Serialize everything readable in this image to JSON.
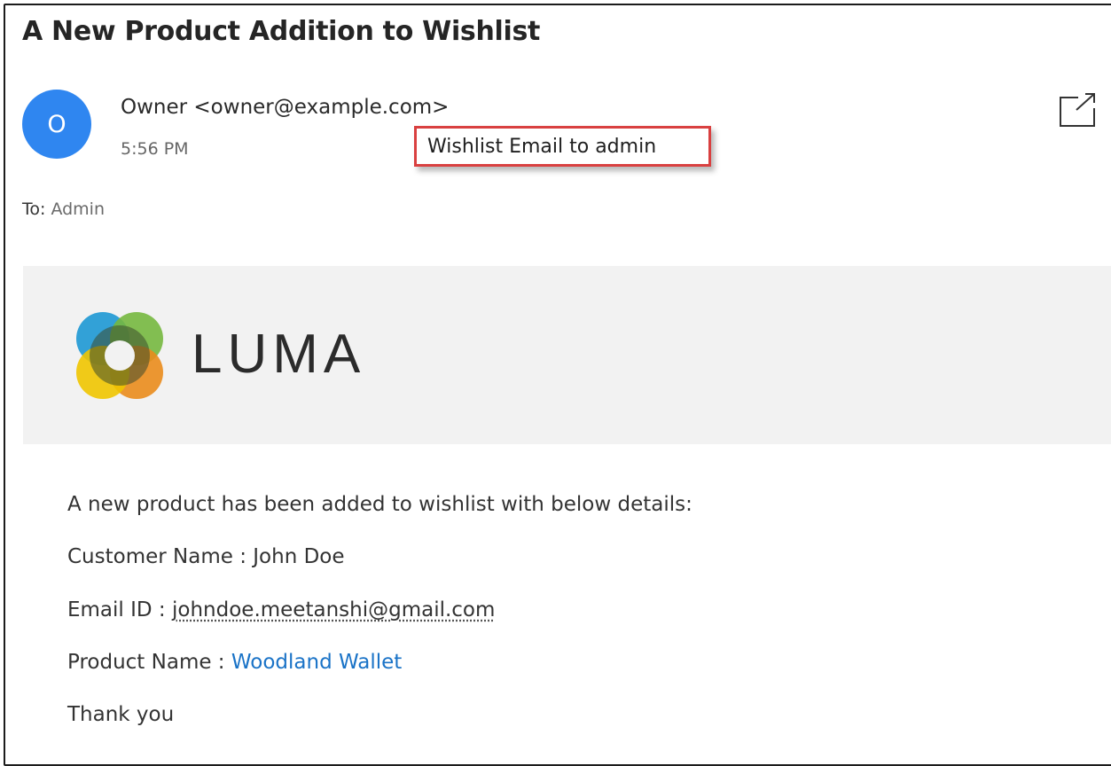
{
  "email": {
    "subject": "A New Product Addition to Wishlist",
    "avatar_initial": "O",
    "sender": "Owner <owner@example.com>",
    "time": "5:56 PM",
    "to_label": "To:",
    "to_value": "Admin",
    "annotation": "Wishlist Email to admin"
  },
  "logo": {
    "text": "LUMA",
    "colors": [
      "#1ea1e0",
      "#7cc242",
      "#f7941d",
      "#fdd000"
    ]
  },
  "body": {
    "intro": "A new product has been added to wishlist with below details:",
    "customer_label": "Customer Name : ",
    "customer_value": "John Doe",
    "email_label": "Email ID : ",
    "email_value": "johndoe.meetanshi@gmail.com",
    "product_label": "Product Name : ",
    "product_value": "Woodland Wallet",
    "closing": "Thank you"
  },
  "icons": {
    "popout": "popout-icon"
  }
}
